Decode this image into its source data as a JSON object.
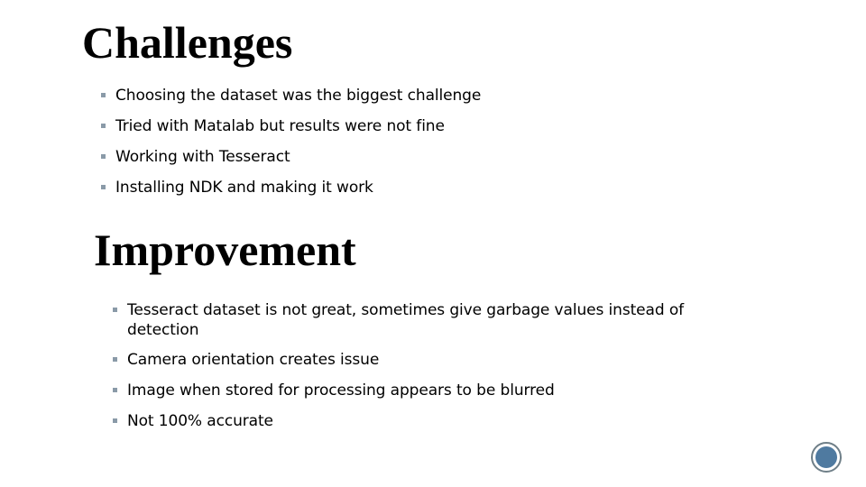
{
  "sections": {
    "challenges": {
      "title": "Challenges",
      "items": [
        "Choosing the dataset was the biggest challenge",
        "Tried with Matalab but results were not fine",
        "Working with Tesseract",
        "Installing NDK and making it work"
      ]
    },
    "improvement": {
      "title": "Improvement",
      "items": [
        "Tesseract dataset is not great, sometimes give garbage values instead of detection",
        "Camera orientation creates issue",
        "Image when stored for processing appears to be blurred",
        "Not 100% accurate"
      ]
    }
  },
  "colors": {
    "bullet": "#8a9aa8",
    "nav_circle_fill": "#4f7aa0",
    "nav_circle_ring": "#6f7f88"
  }
}
